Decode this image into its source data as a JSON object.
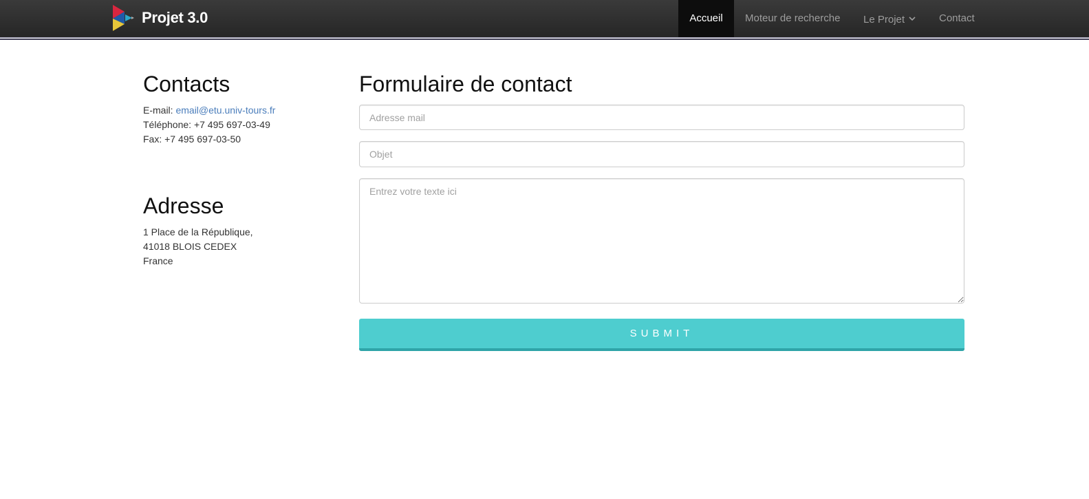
{
  "brand": {
    "title": "Projet 3.0"
  },
  "nav": {
    "home": "Accueil",
    "search": "Moteur de recherche",
    "project": "Le Projet",
    "contact": "Contact"
  },
  "contacts": {
    "heading": "Contacts",
    "email_label": "E-mail: ",
    "email_value": "email@etu.univ-tours.fr",
    "phone": "Téléphone: +7 495 697-03-49",
    "fax": "Fax: +7 495 697-03-50"
  },
  "address": {
    "heading": "Adresse",
    "line1": "1 Place de la République,",
    "line2": "41018 BLOIS CEDEX",
    "line3": "France"
  },
  "form": {
    "heading": "Formulaire de contact",
    "email_placeholder": "Adresse mail",
    "subject_placeholder": "Objet",
    "message_placeholder": "Entrez votre texte ici",
    "submit_label": "SUBMIT"
  },
  "colors": {
    "navbar": "#2c2c2c",
    "active_tab": "#0d0d0d",
    "link": "#4a7dbb",
    "submit": "#4ecdcf"
  }
}
